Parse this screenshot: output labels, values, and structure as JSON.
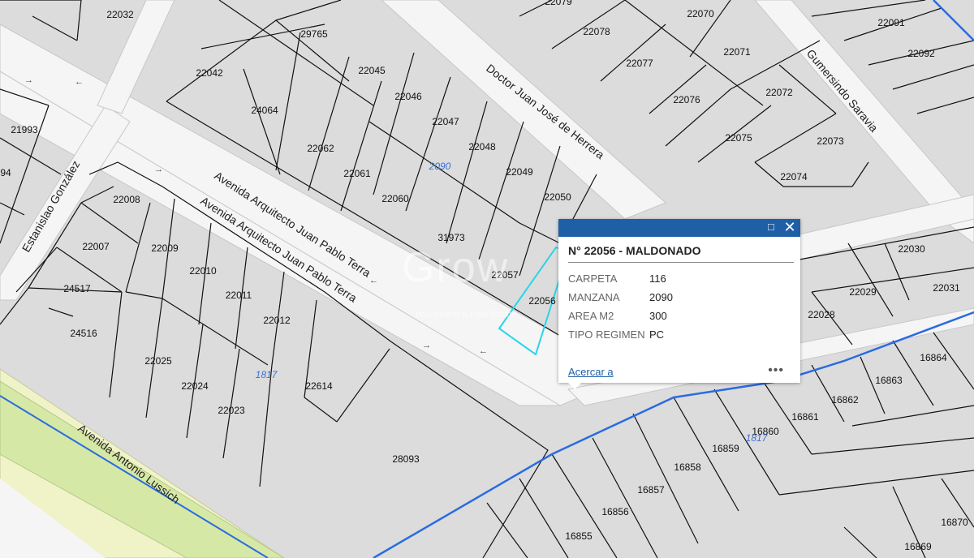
{
  "streets": {
    "doctor_juan_jose": "Doctor Juan José de Herrera",
    "gumersindo": "Gumersindo Saravia",
    "estanislao": "Estanislao González",
    "avenida_terra": "Avenida Arquitecto Juan Pablo Terra",
    "avenida_lussich": "Avenida Antonio Lussich"
  },
  "blocks": {
    "b2090": "2090",
    "b1817a": "1817",
    "b1817b": "1817"
  },
  "lots": {
    "l22032": "22032",
    "l22079": "22079",
    "l22070": "22070",
    "l22091": "22091",
    "l22078": "22078",
    "l22077": "22077",
    "l22071": "22071",
    "l22092": "22092",
    "l29765": "29765",
    "l22042": "22042",
    "l22045": "22045",
    "l22046": "22046",
    "l24064": "24064",
    "l22076": "22076",
    "l22072": "22072",
    "l21993": "21993",
    "l22047": "22047",
    "l22062": "22062",
    "l22048": "22048",
    "l22075": "22075",
    "l22073": "22073",
    "l94": "94",
    "l22061": "22061",
    "l22049": "22049",
    "l22074": "22074",
    "l22008": "22008",
    "l22060": "22060",
    "l22050": "22050",
    "l31973": "31973",
    "l22007": "22007",
    "l22009": "22009",
    "l22010": "22010",
    "l22030": "22030",
    "l22057": "22057",
    "l22029": "22029",
    "l22031": "22031",
    "l24517": "24517",
    "l22011": "22011",
    "l22056": "22056",
    "l22028": "22028",
    "l24516": "24516",
    "l22012": "22012",
    "l16864": "16864",
    "l22025": "22025",
    "l16863": "16863",
    "l22024": "22024",
    "l22614": "22614",
    "l16862": "16862",
    "l22023": "22023",
    "l16861": "16861",
    "l16860": "16860",
    "l16859": "16859",
    "l28093": "28093",
    "l16858": "16858",
    "l16857": "16857",
    "l16856": "16856",
    "l16870": "16870",
    "l16855": "16855",
    "l16869": "16869"
  },
  "watermark": {
    "brand": "Grow",
    "tagline": "Investment & Real Estate"
  },
  "popup": {
    "title": "N° 22056 - MALDONADO",
    "rows": [
      {
        "key": "CARPETA",
        "value": "116"
      },
      {
        "key": "MANZANA",
        "value": "2090"
      },
      {
        "key": "AREA M2",
        "value": "300"
      },
      {
        "key": "TIPO REGIMEN",
        "value": "PC"
      }
    ],
    "zoom_label": "Acercar a",
    "more_label": "•••",
    "maximize_icon": "□",
    "close_icon": "✕"
  },
  "colors": {
    "street_fill": "#f7f7f7",
    "parcel_fill": "#dcdcdc",
    "highlight": "#2ad4e8",
    "river": "#2b6be0",
    "avenue_green": "#d7e8a8",
    "popup_header": "#1f5fa6"
  }
}
